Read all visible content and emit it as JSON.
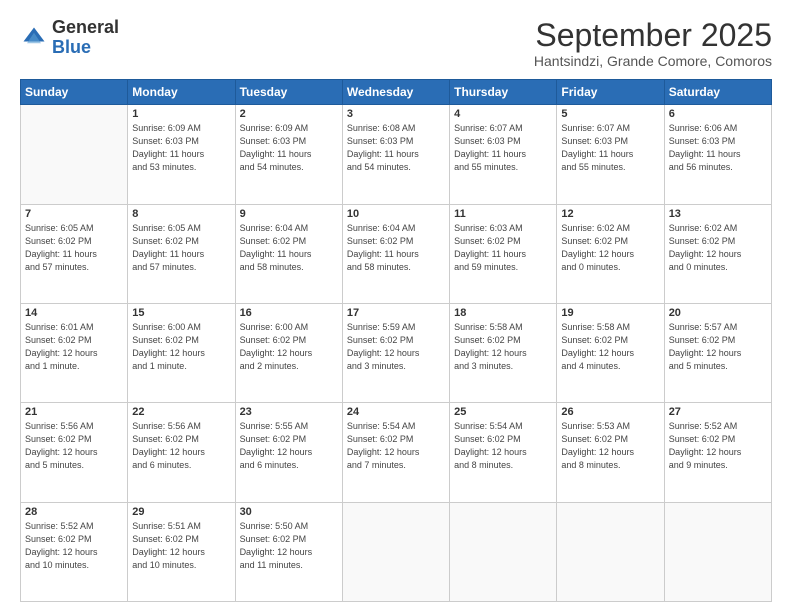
{
  "header": {
    "logo": {
      "general": "General",
      "blue": "Blue"
    },
    "title": "September 2025",
    "subtitle": "Hantsindzi, Grande Comore, Comoros"
  },
  "calendar": {
    "weekdays": [
      "Sunday",
      "Monday",
      "Tuesday",
      "Wednesday",
      "Thursday",
      "Friday",
      "Saturday"
    ],
    "weeks": [
      [
        {
          "day": "",
          "info": ""
        },
        {
          "day": "1",
          "info": "Sunrise: 6:09 AM\nSunset: 6:03 PM\nDaylight: 11 hours\nand 53 minutes."
        },
        {
          "day": "2",
          "info": "Sunrise: 6:09 AM\nSunset: 6:03 PM\nDaylight: 11 hours\nand 54 minutes."
        },
        {
          "day": "3",
          "info": "Sunrise: 6:08 AM\nSunset: 6:03 PM\nDaylight: 11 hours\nand 54 minutes."
        },
        {
          "day": "4",
          "info": "Sunrise: 6:07 AM\nSunset: 6:03 PM\nDaylight: 11 hours\nand 55 minutes."
        },
        {
          "day": "5",
          "info": "Sunrise: 6:07 AM\nSunset: 6:03 PM\nDaylight: 11 hours\nand 55 minutes."
        },
        {
          "day": "6",
          "info": "Sunrise: 6:06 AM\nSunset: 6:03 PM\nDaylight: 11 hours\nand 56 minutes."
        }
      ],
      [
        {
          "day": "7",
          "info": "Sunrise: 6:05 AM\nSunset: 6:02 PM\nDaylight: 11 hours\nand 57 minutes."
        },
        {
          "day": "8",
          "info": "Sunrise: 6:05 AM\nSunset: 6:02 PM\nDaylight: 11 hours\nand 57 minutes."
        },
        {
          "day": "9",
          "info": "Sunrise: 6:04 AM\nSunset: 6:02 PM\nDaylight: 11 hours\nand 58 minutes."
        },
        {
          "day": "10",
          "info": "Sunrise: 6:04 AM\nSunset: 6:02 PM\nDaylight: 11 hours\nand 58 minutes."
        },
        {
          "day": "11",
          "info": "Sunrise: 6:03 AM\nSunset: 6:02 PM\nDaylight: 11 hours\nand 59 minutes."
        },
        {
          "day": "12",
          "info": "Sunrise: 6:02 AM\nSunset: 6:02 PM\nDaylight: 12 hours\nand 0 minutes."
        },
        {
          "day": "13",
          "info": "Sunrise: 6:02 AM\nSunset: 6:02 PM\nDaylight: 12 hours\nand 0 minutes."
        }
      ],
      [
        {
          "day": "14",
          "info": "Sunrise: 6:01 AM\nSunset: 6:02 PM\nDaylight: 12 hours\nand 1 minute."
        },
        {
          "day": "15",
          "info": "Sunrise: 6:00 AM\nSunset: 6:02 PM\nDaylight: 12 hours\nand 1 minute."
        },
        {
          "day": "16",
          "info": "Sunrise: 6:00 AM\nSunset: 6:02 PM\nDaylight: 12 hours\nand 2 minutes."
        },
        {
          "day": "17",
          "info": "Sunrise: 5:59 AM\nSunset: 6:02 PM\nDaylight: 12 hours\nand 3 minutes."
        },
        {
          "day": "18",
          "info": "Sunrise: 5:58 AM\nSunset: 6:02 PM\nDaylight: 12 hours\nand 3 minutes."
        },
        {
          "day": "19",
          "info": "Sunrise: 5:58 AM\nSunset: 6:02 PM\nDaylight: 12 hours\nand 4 minutes."
        },
        {
          "day": "20",
          "info": "Sunrise: 5:57 AM\nSunset: 6:02 PM\nDaylight: 12 hours\nand 5 minutes."
        }
      ],
      [
        {
          "day": "21",
          "info": "Sunrise: 5:56 AM\nSunset: 6:02 PM\nDaylight: 12 hours\nand 5 minutes."
        },
        {
          "day": "22",
          "info": "Sunrise: 5:56 AM\nSunset: 6:02 PM\nDaylight: 12 hours\nand 6 minutes."
        },
        {
          "day": "23",
          "info": "Sunrise: 5:55 AM\nSunset: 6:02 PM\nDaylight: 12 hours\nand 6 minutes."
        },
        {
          "day": "24",
          "info": "Sunrise: 5:54 AM\nSunset: 6:02 PM\nDaylight: 12 hours\nand 7 minutes."
        },
        {
          "day": "25",
          "info": "Sunrise: 5:54 AM\nSunset: 6:02 PM\nDaylight: 12 hours\nand 8 minutes."
        },
        {
          "day": "26",
          "info": "Sunrise: 5:53 AM\nSunset: 6:02 PM\nDaylight: 12 hours\nand 8 minutes."
        },
        {
          "day": "27",
          "info": "Sunrise: 5:52 AM\nSunset: 6:02 PM\nDaylight: 12 hours\nand 9 minutes."
        }
      ],
      [
        {
          "day": "28",
          "info": "Sunrise: 5:52 AM\nSunset: 6:02 PM\nDaylight: 12 hours\nand 10 minutes."
        },
        {
          "day": "29",
          "info": "Sunrise: 5:51 AM\nSunset: 6:02 PM\nDaylight: 12 hours\nand 10 minutes."
        },
        {
          "day": "30",
          "info": "Sunrise: 5:50 AM\nSunset: 6:02 PM\nDaylight: 12 hours\nand 11 minutes."
        },
        {
          "day": "",
          "info": ""
        },
        {
          "day": "",
          "info": ""
        },
        {
          "day": "",
          "info": ""
        },
        {
          "day": "",
          "info": ""
        }
      ]
    ]
  }
}
